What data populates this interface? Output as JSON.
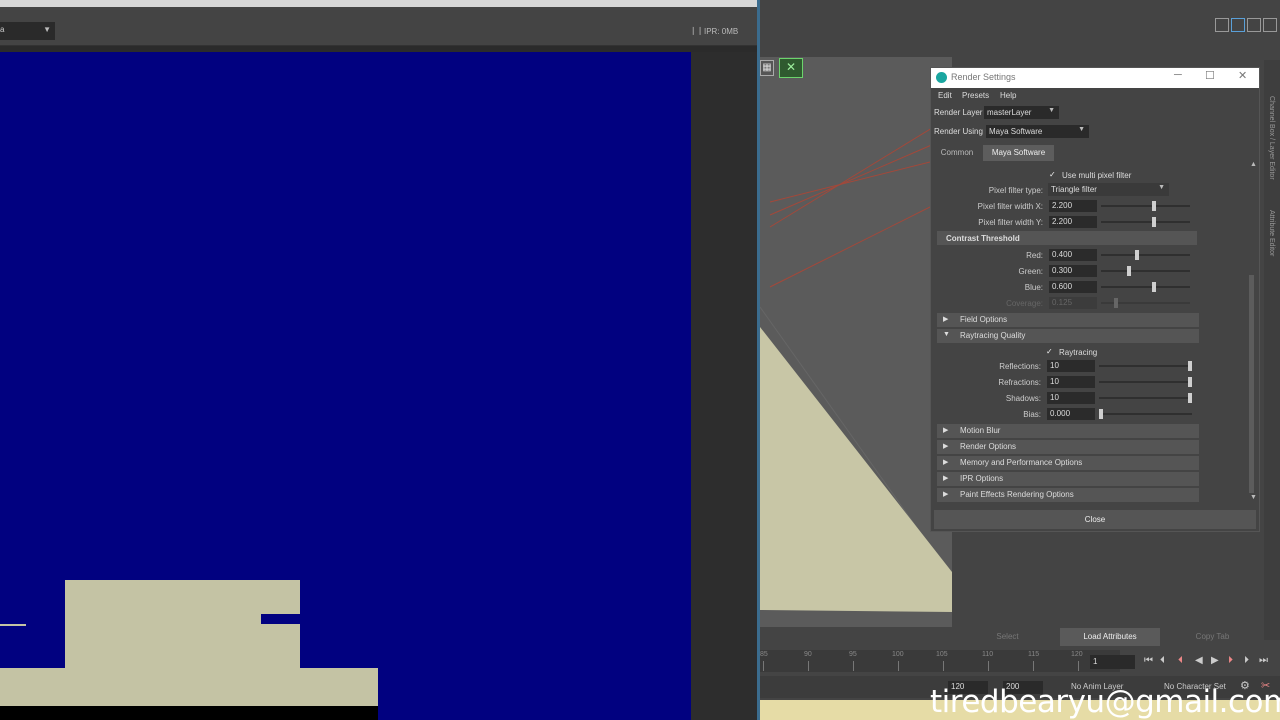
{
  "render_view": {
    "camera_value": "a",
    "pause_icon": "pause-icon",
    "ipr_memory": "IPR: 0MB",
    "background_color": "#010180",
    "geometry_color": "#c4c3a4"
  },
  "viewport": {
    "icons": [
      "grid-icon",
      "camera-toggle-icon"
    ],
    "floor_color": "#c8c6a6"
  },
  "side_tabs": {
    "channel_box": "Channel Box / Layer Editor",
    "attribute_editor": "Attribute Editor"
  },
  "render_settings": {
    "title": "Render Settings",
    "window_buttons": [
      "minimize-icon",
      "maximize-icon",
      "close-icon"
    ],
    "menu": [
      "Edit",
      "Presets",
      "Help"
    ],
    "render_layer_label": "Render Layer",
    "render_layer_value": "masterLayer",
    "render_using_label": "Render Using",
    "render_using_value": "Maya Software",
    "tabs": [
      "Common",
      "Maya Software"
    ],
    "active_tab": "Maya Software",
    "multi_pixel_filter": {
      "label": "Use multi pixel filter",
      "checked": true
    },
    "pixel_filter_type": {
      "label": "Pixel filter type:",
      "value": "Triangle filter"
    },
    "pixel_filter_width_x": {
      "label": "Pixel filter width X:",
      "value": "2.200",
      "fraction": 0.6
    },
    "pixel_filter_width_y": {
      "label": "Pixel filter width Y:",
      "value": "2.200",
      "fraction": 0.6
    },
    "contrast_threshold": {
      "title": "Contrast Threshold",
      "red": {
        "label": "Red:",
        "value": "0.400",
        "fraction": 0.4
      },
      "green": {
        "label": "Green:",
        "value": "0.300",
        "fraction": 0.3
      },
      "blue": {
        "label": "Blue:",
        "value": "0.600",
        "fraction": 0.6
      },
      "coverage": {
        "label": "Coverage:",
        "value": "0.125",
        "fraction": 0.15
      }
    },
    "field_options": "Field Options",
    "raytracing_quality": {
      "title": "Raytracing Quality",
      "raytracing": {
        "label": "Raytracing",
        "checked": true
      },
      "reflections": {
        "label": "Reflections:",
        "value": "10",
        "fraction": 1.0
      },
      "refractions": {
        "label": "Refractions:",
        "value": "10",
        "fraction": 1.0
      },
      "shadows": {
        "label": "Shadows:",
        "value": "10",
        "fraction": 1.0
      },
      "bias": {
        "label": "Bias:",
        "value": "0.000",
        "fraction": 0.0
      }
    },
    "collapsed_sections": [
      "Motion Blur",
      "Render Options",
      "Memory and Performance Options",
      "IPR Options",
      "Paint Effects Rendering Options"
    ],
    "close_button": "Close"
  },
  "attribute_buttons": [
    "Select",
    "Load Attributes",
    "Copy Tab"
  ],
  "time_slider": {
    "ticks": [
      "85",
      "90",
      "95",
      "100",
      "105",
      "110",
      "115",
      "120"
    ],
    "current_frame": "1",
    "playback_icons": [
      "go-to-start-icon",
      "step-back-key-icon",
      "step-back-frame-icon",
      "play-back-icon",
      "play-forward-icon",
      "step-forward-frame-icon",
      "step-forward-key-icon",
      "go-to-end-icon"
    ]
  },
  "range": {
    "end_time": "120",
    "anim_end": "200",
    "anim_layer": "No Anim Layer",
    "character_set": "No Character Set"
  },
  "watermark": "tiredbearyu@gmail.com"
}
